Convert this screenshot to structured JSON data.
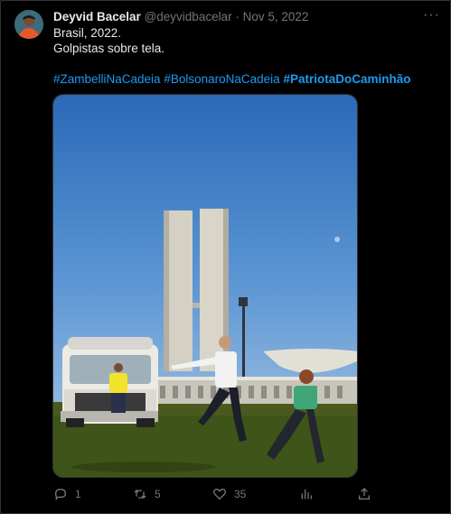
{
  "tweet": {
    "author_name": "Deyvid Bacelar",
    "author_handle": "@deyvidbacelar",
    "separator": "·",
    "date": "Nov 5, 2022",
    "more_label": "···",
    "lines": [
      "Brasil, 2022.",
      "Golpistas sobre tela."
    ],
    "hashtags": [
      {
        "text": "#ZambelliNaCadeia",
        "bold": false
      },
      {
        "text": "#BolsonaroNaCadeia",
        "bold": false
      },
      {
        "text": "#PatriotaDoCaminhão",
        "bold": true
      }
    ]
  },
  "actions": {
    "replies": "1",
    "retweets": "5",
    "likes": "35",
    "views": "",
    "share": ""
  },
  "icons": {
    "reply": "reply-icon",
    "retweet": "retweet-icon",
    "like": "heart-icon",
    "views": "analytics-icon",
    "share": "share-icon"
  },
  "colors": {
    "background": "#000000",
    "text": "#e7e9ea",
    "muted": "#71767b",
    "link": "#1d9bf0"
  }
}
